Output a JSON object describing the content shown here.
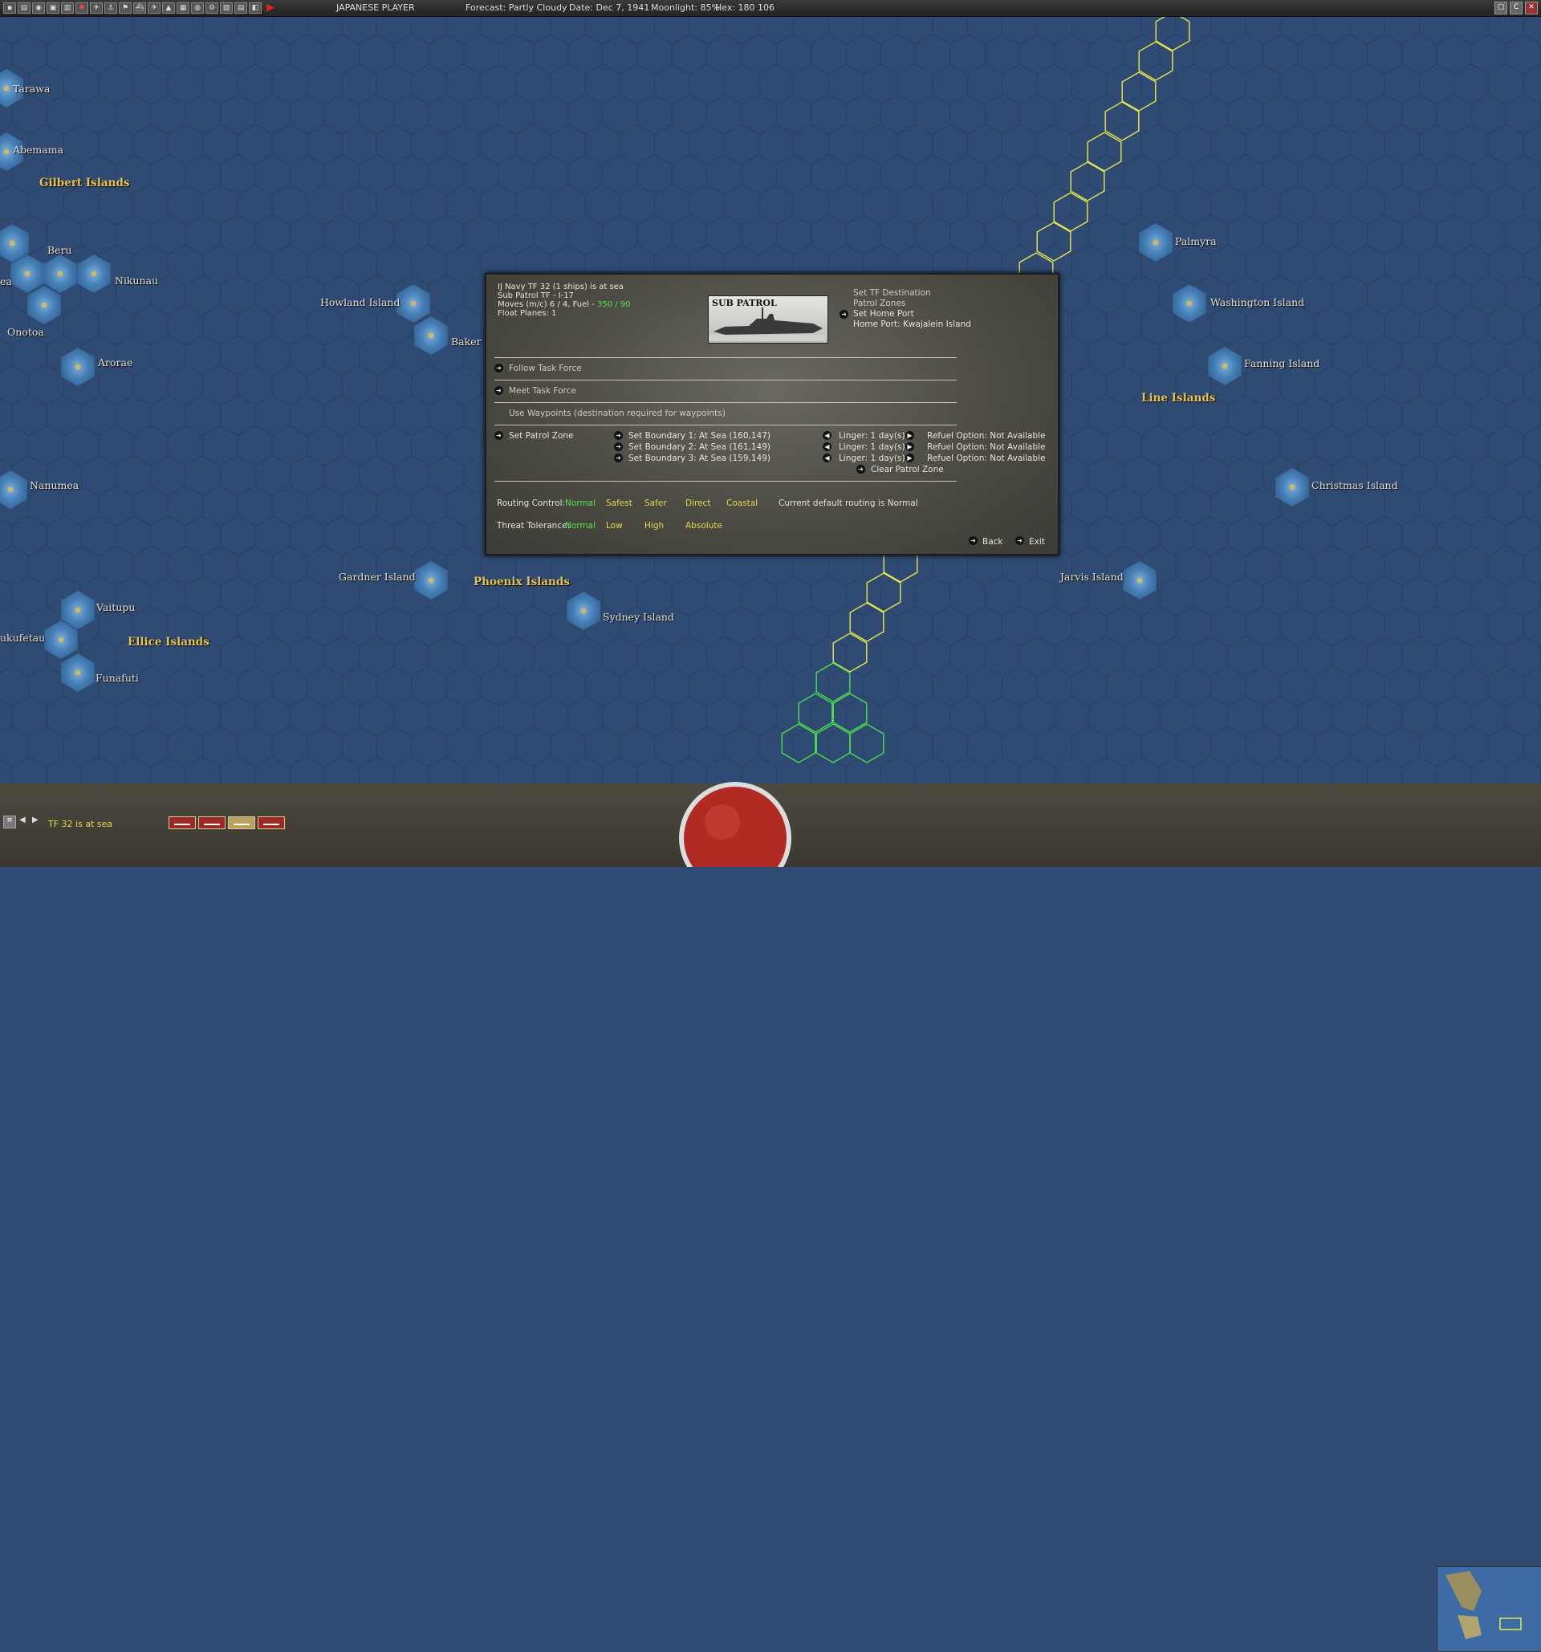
{
  "topbar": {
    "player": "JAPANESE PLAYER",
    "forecast": "Forecast: Partly Cloudy",
    "date": "Date: Dec 7, 1941",
    "moonlight": "Moonlight: 85%",
    "hex": "Hex: 180 106"
  },
  "map": {
    "labels": {
      "tarawa": "Tarawa",
      "abemama": "Abemama",
      "gilbert": "Gilbert Islands",
      "beru": "Beru",
      "nikunau": "Nikunau",
      "ea": "ea",
      "onotoa": "Onotoa",
      "arorae": "Arorae",
      "howland": "Howland Island",
      "baker": "Baker I",
      "nanumea": "Nanumea",
      "gardner": "Gardner Island",
      "phoenix": "Phoenix Islands",
      "sydney": "Sydney Island",
      "vaitupu": "Vaitupu",
      "nukufetau": "ukufetau",
      "ellice": "Ellice Islands",
      "funafuti": "Funafuti",
      "palmyra": "Palmyra",
      "washington": "Washington Island",
      "fanning": "Fanning Island",
      "line": "Line Islands",
      "christmas": "Christmas Island",
      "jarvis": "Jarvis Island"
    }
  },
  "panel": {
    "header1": "IJ Navy TF 32 (1 ships) is at sea",
    "header2": "Sub Patrol TF - I-17",
    "moves_prefix": "Moves (m/c) 6 / 4, Fuel - ",
    "fuel": "350 / 90",
    "float_planes": "Float Planes: 1",
    "image_title": "SUB PATROL",
    "set_destination": "Set TF Destination",
    "patrol_zones": "Patrol Zones",
    "set_home_port": "Set Home Port",
    "home_port": "Home Port: Kwajalein Island",
    "follow_tf": "Follow Task Force",
    "meet_tf": "Meet Task Force",
    "use_waypoints": "Use Waypoints  (destination required for waypoints)",
    "set_patrol_zone": "Set Patrol Zone",
    "boundaries": [
      {
        "label": "Set Boundary 1:  At Sea  (160,147)",
        "linger": "Linger: 1 day(s)",
        "refuel": "Refuel Option:  Not Available"
      },
      {
        "label": "Set Boundary 2:  At Sea  (161,149)",
        "linger": "Linger: 1 day(s)",
        "refuel": "Refuel Option:  Not Available"
      },
      {
        "label": "Set Boundary 3:  At Sea  (159,149)",
        "linger": "Linger: 1 day(s)",
        "refuel": "Refuel Option:  Not Available"
      }
    ],
    "clear_patrol_zone": "Clear Patrol Zone",
    "routing_label": "Routing Control:",
    "routing_options": [
      "Normal",
      "Safest",
      "Safer",
      "Direct",
      "Coastal"
    ],
    "routing_current": "Current default routing is Normal",
    "threat_label": "Threat Tolerance:",
    "threat_options": [
      "Normal",
      "Low",
      "High",
      "Absolute"
    ],
    "back": "Back",
    "exit": "Exit"
  },
  "bottombar": {
    "status": "TF 32 is at sea"
  },
  "colors": {
    "ocean": "#2f4a73",
    "hex_line": "#26405f",
    "route_yellow": "#e8e84a",
    "route_green": "#4be04b",
    "island_glow": "#4a8ac4",
    "region_label": "#e8c34d"
  }
}
